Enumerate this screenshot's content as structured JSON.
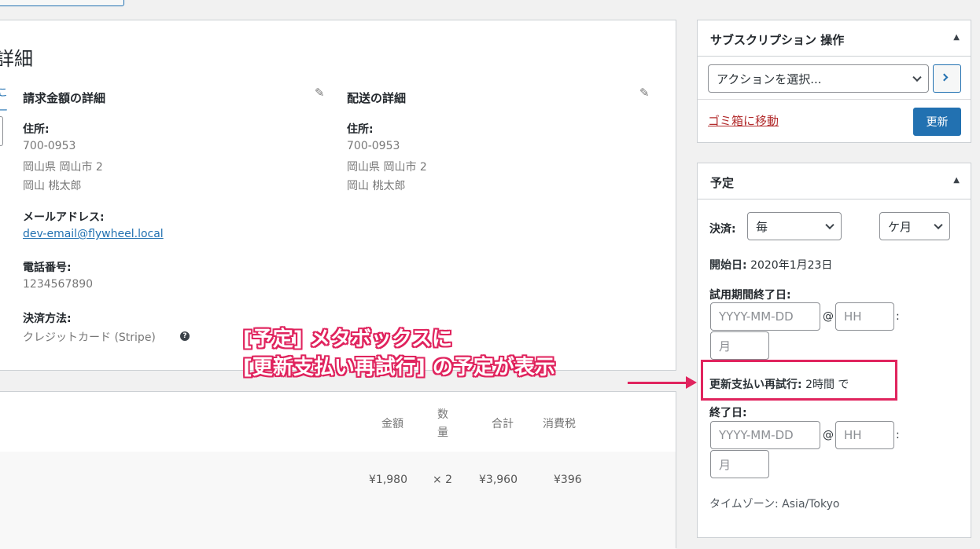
{
  "main": {
    "heading": "詳細",
    "edge_text_1": "こ",
    "edge_text_2": "ー",
    "billing": {
      "title": "請求金額の詳細",
      "address_label": "住所:",
      "address_lines": [
        "700-0953",
        "岡山県 岡山市 2",
        "岡山 桃太郎"
      ],
      "email_label": "メールアドレス:",
      "email": "dev-email@flywheel.local",
      "phone_label": "電話番号:",
      "phone": "1234567890",
      "payment_label": "決済方法:",
      "payment": "クレジットカード (Stripe)"
    },
    "shipping": {
      "title": "配送の詳細",
      "address_label": "住所:",
      "address_lines": [
        "700-0953",
        "岡山県 岡山市 2",
        "岡山 桃太郎"
      ]
    }
  },
  "items": {
    "headers": {
      "amount": "金額",
      "qty_top": "数",
      "qty_bottom": "量",
      "total": "合計",
      "tax": "消費税"
    },
    "row": {
      "amount": "¥1,980",
      "qty": "× 2",
      "total": "¥3,960",
      "tax": "¥396"
    }
  },
  "actions_box": {
    "title": "サブスクリプション 操作",
    "select_value": "アクションを選択...",
    "trash_label": "ゴミ箱に移動",
    "update_label": "更新"
  },
  "schedule_box": {
    "title": "予定",
    "payment_label": "決済:",
    "interval_value": "毎",
    "period_value": "ケ月",
    "start_label": "開始日:",
    "start_value": "2020年1月23日",
    "trial_label": "試用期間終了日:",
    "date_placeholder": "YYYY-MM-DD",
    "at": "@",
    "hour_placeholder": "HH",
    "colon": ":",
    "minute_placeholder": "月",
    "retry_label": "更新支払い再試行:",
    "retry_value": "2時間 で",
    "end_label": "終了日:",
    "timezone": "タイムゾーン: Asia/Tokyo"
  },
  "annotation": {
    "line1": "[予定] メタボックスに",
    "line2": "[更新支払い再試行] の予定が表示"
  },
  "colors": {
    "accent": "#2271b1",
    "highlight": "#e0245e",
    "danger": "#b32d2e"
  }
}
